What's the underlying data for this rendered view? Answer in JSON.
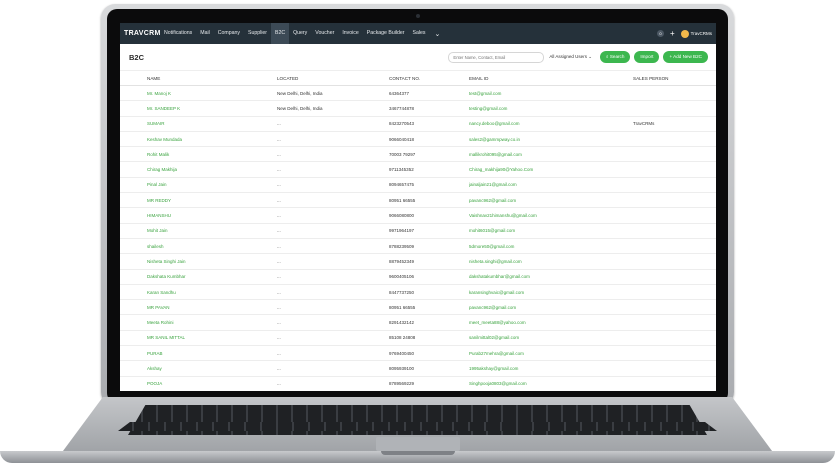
{
  "app": {
    "logo_text": "TRAVCRM",
    "nav_items": [
      "Notifications",
      "Mail",
      "Company",
      "Supplier",
      "B2C",
      "Query",
      "Voucher",
      "Invoice",
      "Package Builder",
      "Sales"
    ],
    "active_nav": "B2C",
    "notification_count": "0",
    "user_name": "TravCRMs"
  },
  "page": {
    "title": "B2C",
    "search_placeholder": "Enter Name, Contact, Email",
    "assigned_filter": "All Assigned Users",
    "search_button": "Search",
    "import_button": "Import",
    "add_button": "+ Add New B2C"
  },
  "table": {
    "columns": [
      "NAME",
      "LOCATED",
      "CONTACT NO.",
      "EMAIL ID",
      "SALES PERSON"
    ],
    "rows": [
      {
        "name": "Mr. Manoj K",
        "located": "New Delhi, Delhi, India",
        "contact": "64364377",
        "email": "test@gmail.com",
        "sales": ""
      },
      {
        "name": "Mr. SANDEEP K",
        "located": "New Delhi, Delhi, India",
        "contact": "3467744878",
        "email": "testing@gmail.com",
        "sales": ""
      },
      {
        "name": "SUMAIR",
        "located": "...",
        "contact": "8423270543",
        "email": "nancy.deboo@gmail.com",
        "sales": "TravCRMs"
      },
      {
        "name": "Keshav Mundada",
        "located": "...",
        "contact": "9066040418",
        "email": "sales2@gammpway.co.in",
        "sales": ""
      },
      {
        "name": "Rohit Malik",
        "located": "...",
        "contact": "70003 79297",
        "email": "mallikrohit095@gmail.com",
        "sales": ""
      },
      {
        "name": "Chirag Makhija",
        "located": "...",
        "contact": "9711345352",
        "email": "Chirag_makhija90@Yahoo.Com",
        "sales": ""
      },
      {
        "name": "Pinal Jain",
        "located": "...",
        "contact": "8094657475",
        "email": "jainaljain21@gmail.com",
        "sales": ""
      },
      {
        "name": "MR REDDY",
        "located": "...",
        "contact": "80951 66555",
        "email": "pavanc962@gmail.com",
        "sales": ""
      },
      {
        "name": "HIMANSHU",
        "located": "...",
        "contact": "9066080800",
        "email": "Vaishnav21himanshu@gmail.com",
        "sales": ""
      },
      {
        "name": "Mohit Jain",
        "located": "...",
        "contact": "9971964197",
        "email": "mohit6015@gmail.com",
        "sales": ""
      },
      {
        "name": "shailesh",
        "located": "...",
        "contact": "8788239509",
        "email": "5dmore50@gmail.com",
        "sales": ""
      },
      {
        "name": "Nisheta Singhi Jain",
        "located": "...",
        "contact": "8879452349",
        "email": "nisheta.singhi@gmail.com",
        "sales": ""
      },
      {
        "name": "Dakshata Kumbhar",
        "located": "...",
        "contact": "9600405106",
        "email": "dakshatakumbhar@gmail.com",
        "sales": ""
      },
      {
        "name": "Karan Sandhu",
        "located": "...",
        "contact": "8447737250",
        "email": "karansinghvaic@gmail.com",
        "sales": ""
      },
      {
        "name": "MR PAVAN",
        "located": "...",
        "contact": "80951 66555",
        "email": "pavanc962@gmail.com",
        "sales": ""
      },
      {
        "name": "Meeta Rohini",
        "located": "...",
        "contact": "8291432142",
        "email": "meet_meeta88@yahoo.com",
        "sales": ""
      },
      {
        "name": "MR SANIL MITTAL",
        "located": "...",
        "contact": "85108 24808",
        "email": "sanilmittal02@gmail.com",
        "sales": ""
      },
      {
        "name": "PURAB",
        "located": "...",
        "contact": "9769400450",
        "email": "Purab27mehra@gmail.com",
        "sales": ""
      },
      {
        "name": "Akshay",
        "located": "...",
        "contact": "8095939100",
        "email": "1995akshay@gmail.com",
        "sales": ""
      },
      {
        "name": "POOJA",
        "located": "...",
        "contact": "8789569229",
        "email": "Singhpooja0803@gmail.com",
        "sales": ""
      }
    ]
  }
}
